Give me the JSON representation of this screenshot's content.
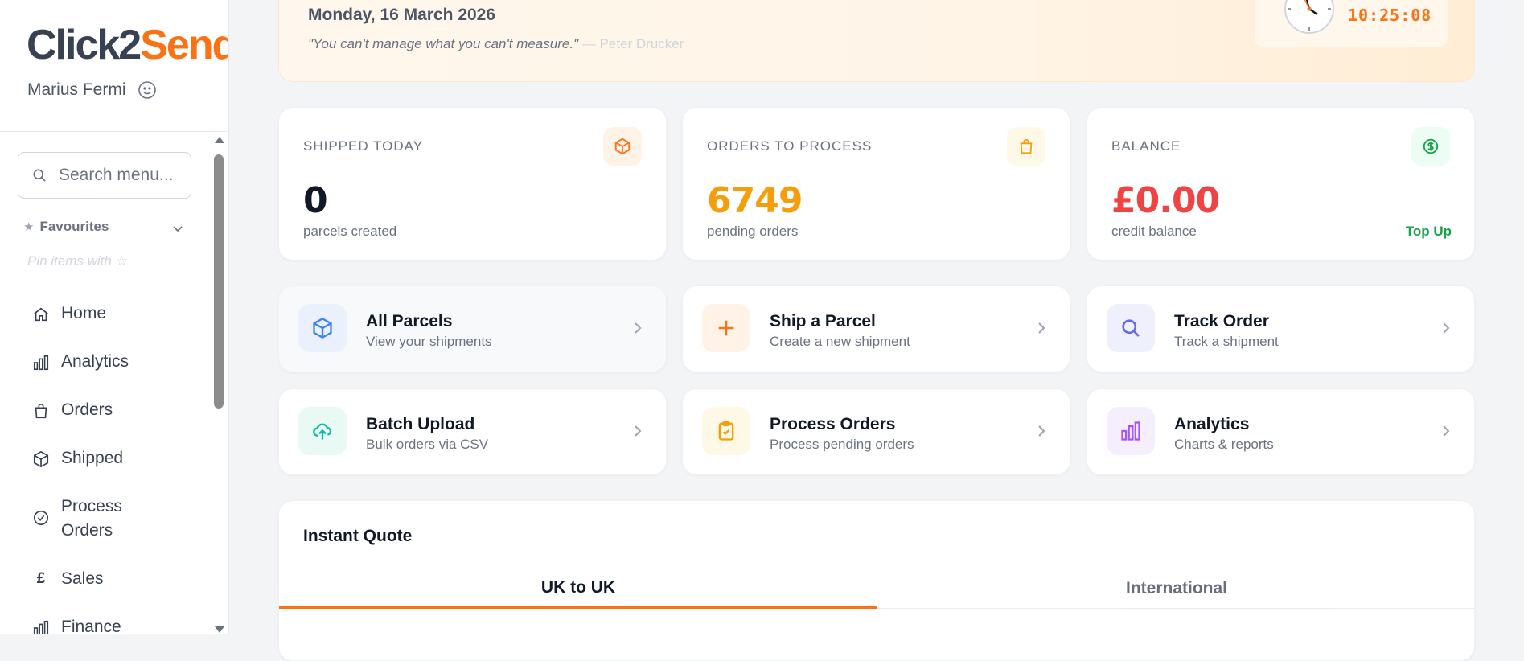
{
  "brand": {
    "part1": "Click2",
    "part2": "Send"
  },
  "user": {
    "name": "Marius Fermi"
  },
  "search": {
    "placeholder": "Search menu..."
  },
  "favourites": {
    "label": "Favourites",
    "hint": "Pin items with ☆"
  },
  "nav": [
    {
      "label": "Home",
      "icon": "home-icon"
    },
    {
      "label": "Analytics",
      "icon": "bar-chart-icon"
    },
    {
      "label": "Orders",
      "icon": "shopping-bag-icon"
    },
    {
      "label": "Shipped",
      "icon": "box-icon"
    },
    {
      "label": "Process Orders",
      "icon": "check-circle-icon"
    },
    {
      "label": "Sales",
      "icon": "pound-icon"
    },
    {
      "label": "Finance",
      "icon": "bar-chart-icon"
    }
  ],
  "hero": {
    "date": "Monday, 16 March 2026",
    "quote": "\"You can't manage what you can't measure.\"",
    "author": "— Peter Drucker",
    "time": "10:25:08"
  },
  "stats": [
    {
      "label": "SHIPPED TODAY",
      "value": "0",
      "sub": "parcels created",
      "icon": "box-icon",
      "color": "#111827",
      "icon_bg": "#fff3e8",
      "icon_color": "#f97316"
    },
    {
      "label": "ORDERS TO PROCESS",
      "value": "6749",
      "sub": "pending orders",
      "icon": "shopping-bag-icon",
      "color": "#f59e0b",
      "icon_bg": "#fef9e7",
      "icon_color": "#f59e0b"
    },
    {
      "label": "BALANCE",
      "value": "£0.00",
      "sub": "credit balance",
      "icon": "dollar-circle-icon",
      "color": "#ef4444",
      "icon_bg": "#ecfdf3",
      "icon_color": "#16a34a",
      "link": "Top Up"
    }
  ],
  "actions": [
    {
      "title": "All Parcels",
      "sub": "View your shipments",
      "icon": "box-icon",
      "icon_bg": "#eaf1fd",
      "icon_color": "#3b82f6"
    },
    {
      "title": "Ship a Parcel",
      "sub": "Create a new shipment",
      "icon": "plus-icon",
      "icon_bg": "#fff3e8",
      "icon_color": "#f97316"
    },
    {
      "title": "Track Order",
      "sub": "Track a shipment",
      "icon": "search-icon",
      "icon_bg": "#eef0fc",
      "icon_color": "#6366f1"
    },
    {
      "title": "Batch Upload",
      "sub": "Bulk orders via CSV",
      "icon": "upload-cloud-icon",
      "icon_bg": "#e9faf5",
      "icon_color": "#14b8a6"
    },
    {
      "title": "Process Orders",
      "sub": "Process pending orders",
      "icon": "clipboard-check-icon",
      "icon_bg": "#fef9e7",
      "icon_color": "#f59e0b"
    },
    {
      "title": "Analytics",
      "sub": "Charts & reports",
      "icon": "bar-chart-icon",
      "icon_bg": "#f5effd",
      "icon_color": "#a855f7"
    }
  ],
  "quote_card": {
    "title": "Instant Quote",
    "tabs": [
      {
        "label": "UK to UK",
        "active": true
      },
      {
        "label": "International",
        "active": false
      }
    ]
  },
  "colors": {
    "accent": "#f97316",
    "success": "#16a34a"
  }
}
